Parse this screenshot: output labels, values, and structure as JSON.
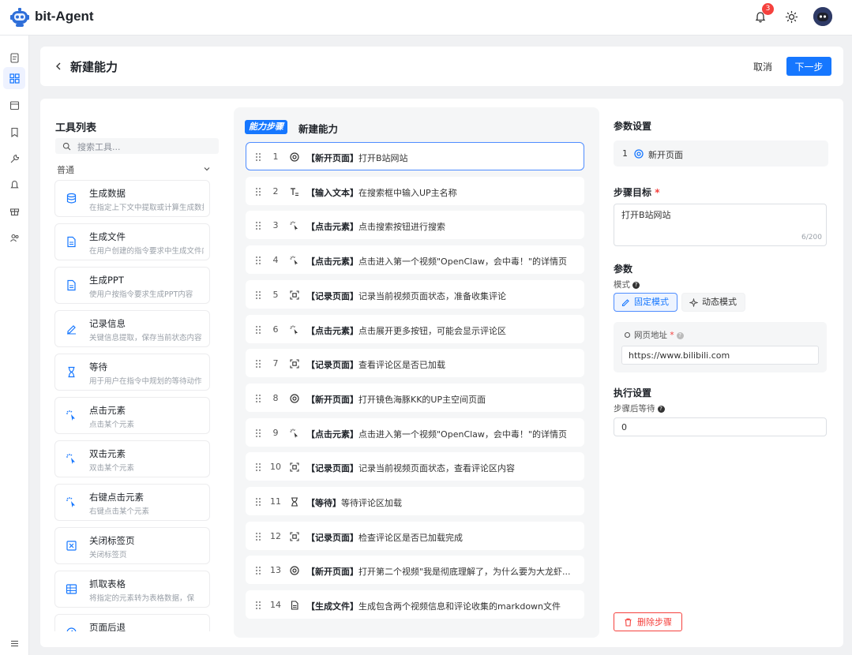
{
  "app": {
    "title": "bit-Agent",
    "notification_count": "3"
  },
  "header": {
    "title": "新建能力",
    "cancel_label": "取消",
    "next_label": "下一步"
  },
  "tools": {
    "title": "工具列表",
    "search_placeholder": "搜索工具...",
    "group_label": "普通",
    "items": [
      {
        "name": "生成数据",
        "desc": "在指定上下文中提取或计算生成数据",
        "icon": "database-icon"
      },
      {
        "name": "生成文件",
        "desc": "在用户创建的指令要求中生成文件内容",
        "icon": "file-icon"
      },
      {
        "name": "生成PPT",
        "desc": "使用户按指令要求生成PPT内容",
        "icon": "ppt-icon"
      },
      {
        "name": "记录信息",
        "desc": "关键信息提取，保存当前状态内容",
        "icon": "edit-icon"
      },
      {
        "name": "等待",
        "desc": "用于用户在指令中规划的等待动作",
        "icon": "hourglass-icon"
      },
      {
        "name": "点击元素",
        "desc": "点击某个元素",
        "icon": "click-icon"
      },
      {
        "name": "双击元素",
        "desc": "双击某个元素",
        "icon": "double-click-icon"
      },
      {
        "name": "右键点击元素",
        "desc": "右键点击某个元素",
        "icon": "right-click-icon"
      },
      {
        "name": "关闭标签页",
        "desc": "关闭标签页",
        "icon": "close-tab-icon"
      },
      {
        "name": "抓取表格",
        "desc": "将指定的元素转为表格数据，保",
        "icon": "table-icon"
      },
      {
        "name": "页面后退",
        "desc": "",
        "icon": "back-icon"
      }
    ]
  },
  "steps": {
    "tag": "能力步骤",
    "title": "新建能力",
    "items": [
      {
        "num": "1",
        "icon": "chrome-icon",
        "type": "【新开页面】",
        "text": "打开B站网站"
      },
      {
        "num": "2",
        "icon": "text-input-icon",
        "type": "【输入文本】",
        "text": "在搜索框中输入UP主名称"
      },
      {
        "num": "3",
        "icon": "click-icon",
        "type": "【点击元素】",
        "text": "点击搜索按钮进行搜索"
      },
      {
        "num": "4",
        "icon": "click-icon",
        "type": "【点击元素】",
        "text": "点击进入第一个视频\"OpenClaw，会中毒！\"的详情页"
      },
      {
        "num": "5",
        "icon": "record-icon",
        "type": "【记录页面】",
        "text": "记录当前视频页面状态，准备收集评论"
      },
      {
        "num": "6",
        "icon": "click-icon",
        "type": "【点击元素】",
        "text": "点击展开更多按钮，可能会显示评论区"
      },
      {
        "num": "7",
        "icon": "record-icon",
        "type": "【记录页面】",
        "text": "查看评论区是否已加载"
      },
      {
        "num": "8",
        "icon": "chrome-icon",
        "type": "【新开页面】",
        "text": "打开镜色海豚KK的UP主空间页面"
      },
      {
        "num": "9",
        "icon": "click-icon",
        "type": "【点击元素】",
        "text": "点击进入第一个视频\"OpenClaw，会中毒！\"的详情页"
      },
      {
        "num": "10",
        "icon": "record-icon",
        "type": "【记录页面】",
        "text": "记录当前视频页面状态，查看评论区内容"
      },
      {
        "num": "11",
        "icon": "hourglass-icon",
        "type": "【等待】",
        "text": "等待评论区加载"
      },
      {
        "num": "12",
        "icon": "record-icon",
        "type": "【记录页面】",
        "text": "检查评论区是否已加载完成"
      },
      {
        "num": "13",
        "icon": "chrome-icon",
        "type": "【新开页面】",
        "text": "打开第二个视频\"我是彻底理解了，为什么要为大龙虾..."
      },
      {
        "num": "14",
        "icon": "file-icon",
        "type": "【生成文件】",
        "text": "生成包含两个视频信息和评论收集的markdown文件"
      }
    ]
  },
  "params": {
    "title": "参数设置",
    "selected_step_num": "1",
    "selected_step_label": "新开页面",
    "goal_label": "步骤目标",
    "goal_value": "打开B站网站",
    "goal_count": "6/200",
    "params_label": "参数",
    "mode_label": "模式",
    "mode_static": "固定模式",
    "mode_dynamic": "动态模式",
    "url_label": "网页地址",
    "url_value": "https://www.bilibili.com",
    "exec_title": "执行设置",
    "wait_label": "步骤后等待",
    "wait_value": "0",
    "delete_label": "删除步骤"
  },
  "colors": {
    "primary": "#1677ff",
    "danger": "#f5413d",
    "badge": "#f5413d"
  }
}
